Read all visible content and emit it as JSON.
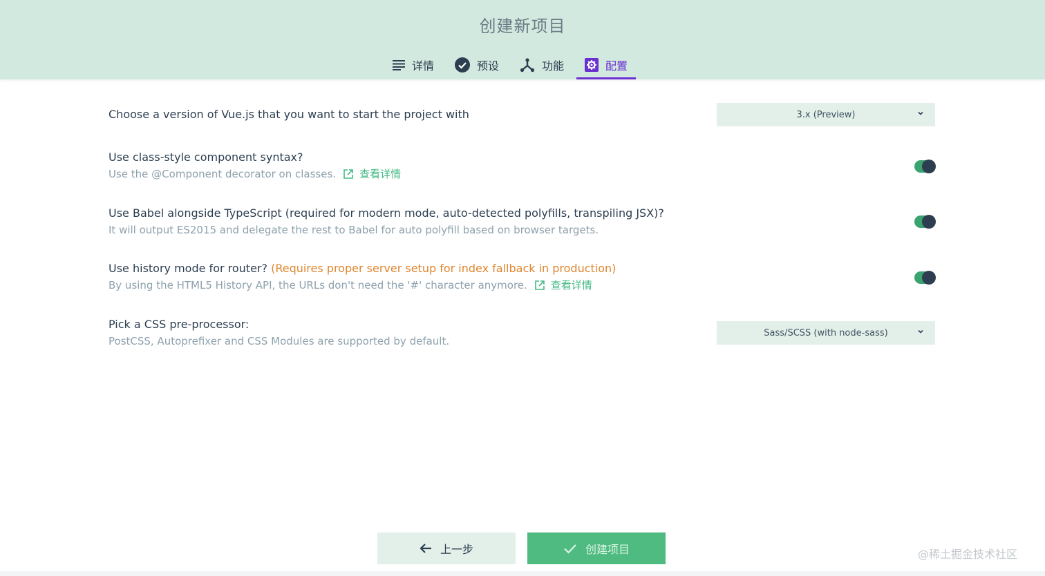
{
  "header": {
    "title": "创建新项目",
    "tabs": [
      {
        "label": "详情",
        "icon": "list-icon"
      },
      {
        "label": "预设",
        "icon": "check-circle-icon"
      },
      {
        "label": "功能",
        "icon": "fork-icon"
      },
      {
        "label": "配置",
        "icon": "settings-icon",
        "active": true
      }
    ]
  },
  "options": {
    "vue_version": {
      "title": "Choose a version of Vue.js that you want to start the project with",
      "selected": "3.x (Preview)"
    },
    "class_style": {
      "title": "Use class-style component syntax?",
      "desc": "Use the @Component decorator on classes.",
      "link": "查看详情",
      "enabled": true
    },
    "babel": {
      "title": "Use Babel alongside TypeScript (required for modern mode, auto-detected polyfills, transpiling JSX)?",
      "desc": "It will output ES2015 and delegate the rest to Babel for auto polyfill based on browser targets.",
      "enabled": true
    },
    "history": {
      "title": "Use history mode for router?",
      "warning": "(Requires proper server setup for index fallback in production)",
      "desc": "By using the HTML5 History API, the URLs don't need the '#' character anymore.",
      "link": "查看详情",
      "enabled": true
    },
    "css": {
      "title": "Pick a CSS pre-processor:",
      "desc": "PostCSS, Autoprefixer and CSS Modules are supported by default.",
      "selected": "Sass/SCSS (with node-sass)"
    }
  },
  "footer": {
    "prev_label": "上一步",
    "create_label": "创建项目"
  },
  "watermark": "@稀土掘金技术社区",
  "colors": {
    "header_bg": "#d2e9df",
    "accent": "#6a2fd0",
    "green": "#42b983",
    "warning": "#e0852e"
  }
}
